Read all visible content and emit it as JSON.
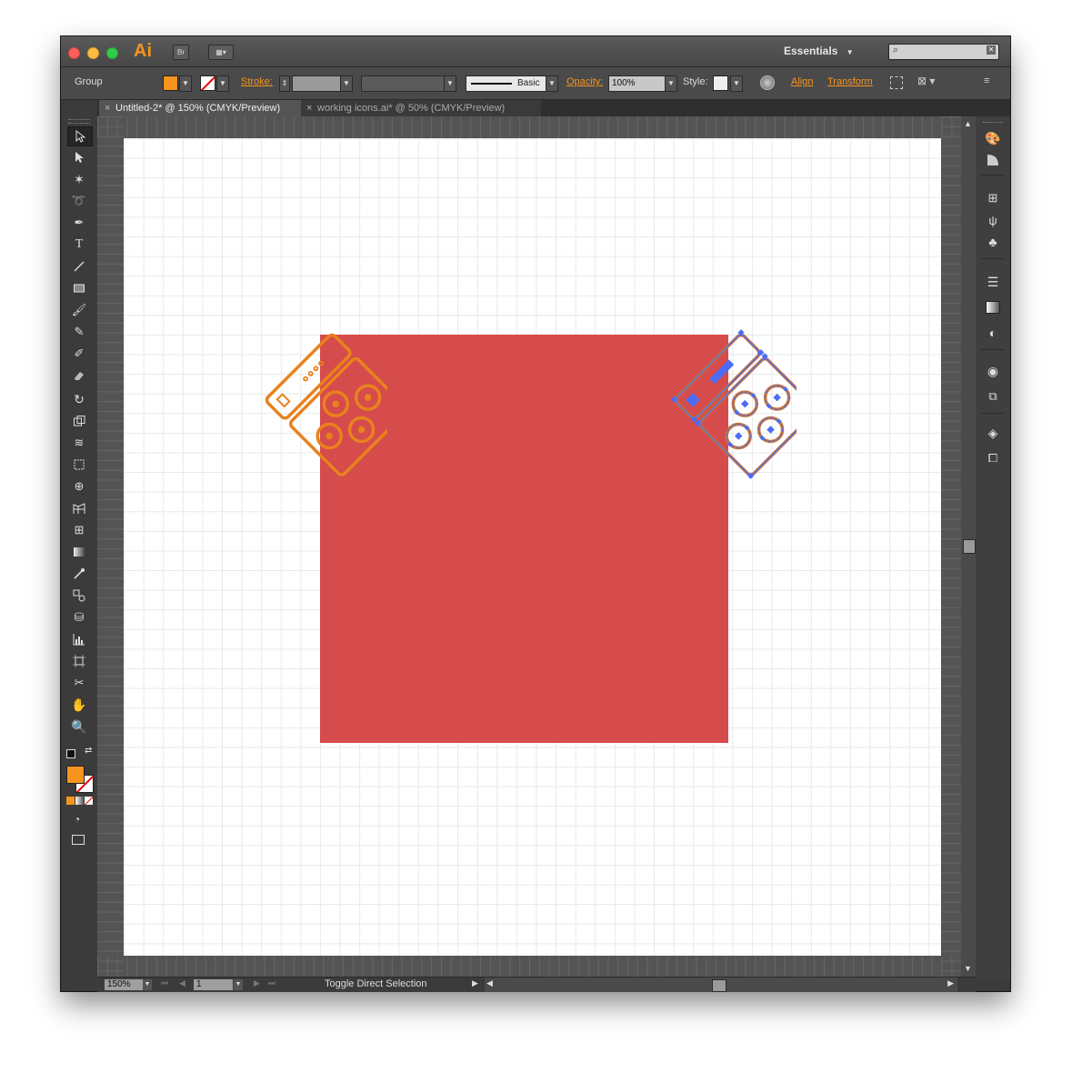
{
  "app": {
    "logo": "Ai",
    "bridge_label": "Br",
    "workspace": "Essentials"
  },
  "control_bar": {
    "selection_type": "Group",
    "stroke_label": "Stroke:",
    "brush_label": "Basic",
    "opacity_label": "Opacity:",
    "opacity_value": "100%",
    "style_label": "Style:",
    "align_label": "Align",
    "transform_label": "Transform",
    "fill_color": "#f7941d"
  },
  "tabs": [
    {
      "label": "Untitled-2* @ 150% (CMYK/Preview)",
      "active": true
    },
    {
      "label": "working icons.ai* @ 50% (CMYK/Preview)",
      "active": false
    }
  ],
  "tools": [
    "selection-tool",
    "direct-selection-tool",
    "magic-wand-tool",
    "lasso-tool",
    "pen-tool",
    "type-tool",
    "line-tool",
    "rectangle-tool",
    "paintbrush-tool",
    "pencil-tool",
    "blob-brush-tool",
    "eraser-tool",
    "rotate-tool",
    "scale-tool",
    "width-tool",
    "free-transform-tool",
    "shape-builder-tool",
    "perspective-grid-tool",
    "mesh-tool",
    "gradient-tool",
    "eyedropper-tool",
    "blend-tool",
    "symbol-sprayer-tool",
    "column-graph-tool",
    "artboard-tool",
    "slice-tool",
    "hand-tool",
    "zoom-tool"
  ],
  "panels": [
    "color-panel",
    "color-guide-panel",
    "swatches-panel",
    "brushes-panel",
    "symbols-panel",
    "stroke-panel",
    "gradient-panel",
    "transparency-panel",
    "appearance-panel",
    "graphic-styles-panel",
    "layers-panel",
    "artboards-panel"
  ],
  "canvas": {
    "artboard_color": "#ffffff",
    "square_color": "#d64b4b",
    "icon_color": "#e8821e",
    "selection_color": "#4a6cf7"
  },
  "status": {
    "zoom": "150%",
    "artboard_number": "1",
    "status_text": "Toggle Direct Selection"
  }
}
